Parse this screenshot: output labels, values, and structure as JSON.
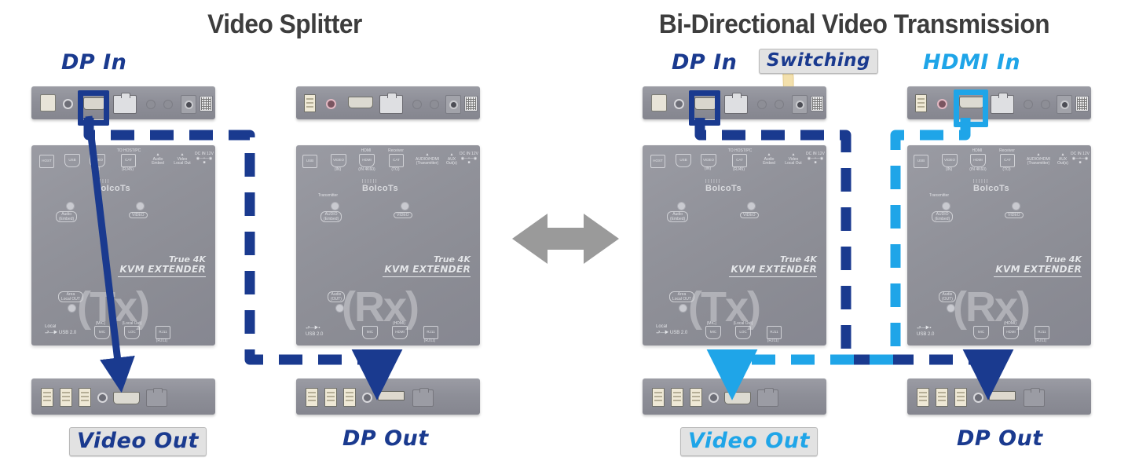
{
  "diagram": {
    "colors": {
      "navy": "#1a3a8f",
      "cyan": "#1fa5e8",
      "title_gray": "#3d3d3d",
      "device_gray": "#8e8f98",
      "center_arrow_gray": "#9a9a9a",
      "label_box_bg": "#e2e2e2"
    },
    "panels": [
      {
        "id": "video-splitter",
        "title": "Video Splitter",
        "labels": {
          "source_in": "DP In",
          "left_out": "Video Out",
          "right_out": "DP Out"
        },
        "devices": [
          {
            "role": "Tx",
            "watermark": "(Tx)",
            "model_line1": "True 4K",
            "model_line2": "KVM EXTENDER",
            "brand": "BoIcoTs"
          },
          {
            "role": "Rx",
            "watermark": "(Rx)",
            "model_line1": "True 4K",
            "model_line2": "KVM EXTENDER",
            "brand": "BoIcoTs"
          }
        ],
        "cables": [
          {
            "name": "dp-in-to-video-out",
            "color": "#1a3a8f",
            "style": "solid",
            "from": "DP In",
            "to": "Video Out"
          },
          {
            "name": "dp-in-to-dp-out",
            "color": "#1a3a8f",
            "style": "dashed",
            "from": "DP In",
            "to": "DP Out"
          }
        ]
      },
      {
        "id": "bi-directional-video-transmission",
        "title": "Bi-Directional Video Transmission",
        "labels": {
          "source_in_left": "DP In",
          "source_in_right": "HDMI In",
          "switching": "Switching",
          "left_out": "Video Out",
          "right_out": "DP Out"
        },
        "devices": [
          {
            "role": "Tx",
            "watermark": "(Tx)",
            "model_line1": "True 4K",
            "model_line2": "KVM EXTENDER",
            "brand": "BoIcoTs"
          },
          {
            "role": "Rx",
            "watermark": "(Rx)",
            "model_line1": "True 4K",
            "model_line2": "KVM EXTENDER",
            "brand": "BoIcoTs"
          }
        ],
        "cables": [
          {
            "name": "dp-in-to-dp-out",
            "color": "#1a3a8f",
            "style": "dashed",
            "from": "DP In",
            "to": "DP Out"
          },
          {
            "name": "hdmi-in-to-video-out",
            "color": "#1fa5e8",
            "style": "dashed",
            "from": "HDMI In",
            "to": "Video Out"
          }
        ]
      }
    ],
    "center_arrow": {
      "name": "bidirectional-arrow",
      "direction": "left-right"
    },
    "device_face_icons": {
      "tx_row": [
        "HOST",
        "USB",
        "VIDEO IN",
        "CAT",
        "Audio Embed",
        "Video Local Out",
        "DC IN"
      ],
      "rx_row": [
        "USB",
        "VIDEO",
        "HDMI",
        "CAT",
        "AUDIO",
        "DC IN"
      ],
      "tx_leds": [
        "Audio Embed",
        "VIDEO"
      ],
      "rx_leds": [
        "Transmitter AUDIO (Embed)",
        "VIDEO"
      ],
      "tx_bottom": [
        "Local USB 2.0",
        "MIC",
        "Local Out",
        "RJ11"
      ],
      "rx_bottom": [
        "USB 2.0",
        "MIC",
        "HDMI",
        "RJ11"
      ]
    }
  }
}
